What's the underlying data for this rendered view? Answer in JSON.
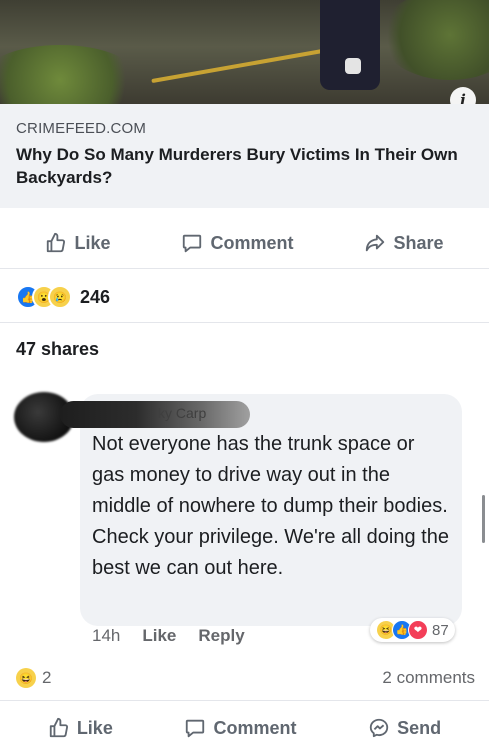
{
  "link_preview": {
    "info_badge": "i",
    "domain": "CRIMEFEED.COM",
    "headline": "Why Do So Many Murderers Bury Victims In Their Own Backyards?"
  },
  "post_actions": {
    "like": "Like",
    "comment": "Comment",
    "share": "Share"
  },
  "reactions": {
    "icons": [
      "like-icon",
      "wow-icon",
      "sad-icon"
    ],
    "count": "246"
  },
  "shares": "47 shares",
  "comment": {
    "author_visible": "ky Carp",
    "text": "Not everyone has the trunk space or gas money to drive way out in the middle of nowhere to dump their bodies. Check your privilege. We're all doing the best we can out here.",
    "time": "14h",
    "like": "Like",
    "reply": "Reply",
    "reaction_icons": [
      "haha-icon",
      "like-icon",
      "love-icon"
    ],
    "reaction_count": "87"
  },
  "footer_stats": {
    "reaction_icon": "haha-icon",
    "reaction_count": "2",
    "comments": "2 comments"
  },
  "bottom_actions": {
    "like": "Like",
    "comment": "Comment",
    "send": "Send"
  },
  "colors": {
    "brand_blue": "#1877f2",
    "text_primary": "#1c1e21",
    "text_secondary": "#65676b",
    "bubble_bg": "#f0f2f5"
  }
}
